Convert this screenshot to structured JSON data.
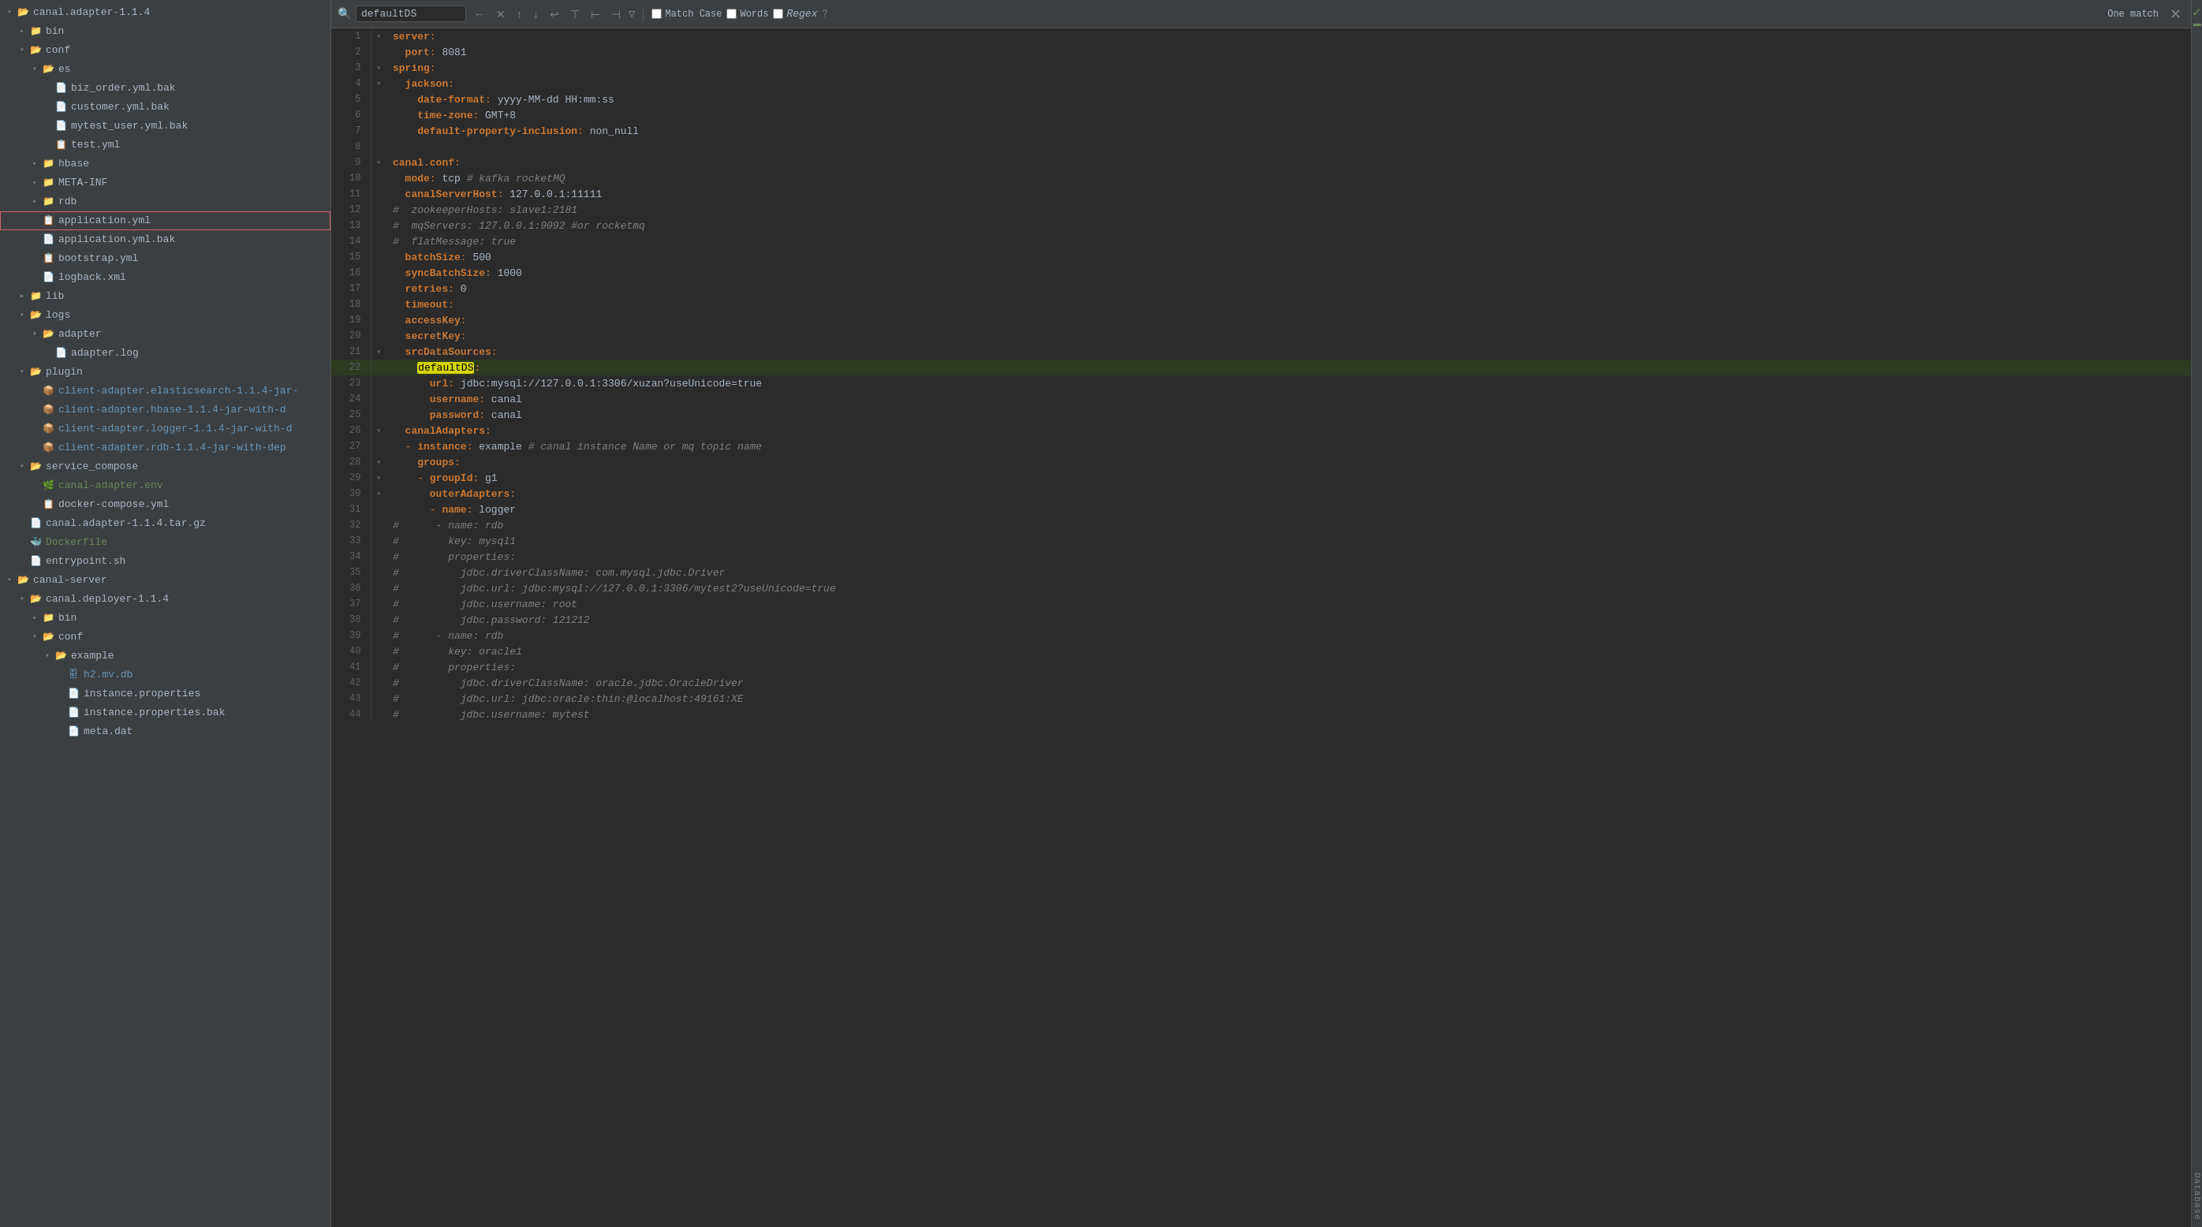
{
  "sidebar": {
    "items": [
      {
        "id": "canal-adapter-root",
        "label": "canal.adapter-1.1.4",
        "type": "folder",
        "depth": 0,
        "open": true,
        "icon": "folder"
      },
      {
        "id": "bin",
        "label": "bin",
        "type": "folder",
        "depth": 1,
        "open": false,
        "icon": "folder"
      },
      {
        "id": "conf",
        "label": "conf",
        "type": "folder",
        "depth": 1,
        "open": true,
        "icon": "folder"
      },
      {
        "id": "es",
        "label": "es",
        "type": "folder",
        "depth": 2,
        "open": true,
        "icon": "folder"
      },
      {
        "id": "biz_order",
        "label": "biz_order.yml.bak",
        "type": "file-bak",
        "depth": 3,
        "icon": "file"
      },
      {
        "id": "customer",
        "label": "customer.yml.bak",
        "type": "file-bak",
        "depth": 3,
        "icon": "file"
      },
      {
        "id": "mytest_user",
        "label": "mytest_user.yml.bak",
        "type": "file-bak",
        "depth": 3,
        "icon": "file"
      },
      {
        "id": "test_yml",
        "label": "test.yml",
        "type": "file-yml",
        "depth": 3,
        "icon": "file-yml"
      },
      {
        "id": "hbase",
        "label": "hbase",
        "type": "folder",
        "depth": 2,
        "open": false,
        "icon": "folder"
      },
      {
        "id": "META-INF",
        "label": "META-INF",
        "type": "folder",
        "depth": 2,
        "open": false,
        "icon": "folder"
      },
      {
        "id": "rdb",
        "label": "rdb",
        "type": "folder",
        "depth": 2,
        "open": false,
        "icon": "folder"
      },
      {
        "id": "application_yml",
        "label": "application.yml",
        "type": "file-yml",
        "depth": 2,
        "icon": "file-yml",
        "selected": true,
        "highlighted": true
      },
      {
        "id": "application_yml_bak",
        "label": "application.yml.bak",
        "type": "file-bak",
        "depth": 2,
        "icon": "file"
      },
      {
        "id": "bootstrap_yml",
        "label": "bootstrap.yml",
        "type": "file-yml",
        "depth": 2,
        "icon": "file-yml"
      },
      {
        "id": "logback_xml",
        "label": "logback.xml",
        "type": "file-xml",
        "depth": 2,
        "icon": "file"
      },
      {
        "id": "lib",
        "label": "lib",
        "type": "folder",
        "depth": 1,
        "open": false,
        "icon": "folder"
      },
      {
        "id": "logs",
        "label": "logs",
        "type": "folder",
        "depth": 1,
        "open": true,
        "icon": "folder"
      },
      {
        "id": "adapter",
        "label": "adapter",
        "type": "folder",
        "depth": 2,
        "open": true,
        "icon": "folder"
      },
      {
        "id": "adapter_log",
        "label": "adapter.log",
        "type": "file-log",
        "depth": 3,
        "icon": "file"
      },
      {
        "id": "plugin",
        "label": "plugin",
        "type": "folder",
        "depth": 1,
        "open": true,
        "icon": "folder"
      },
      {
        "id": "client-es",
        "label": "client-adapter.elasticsearch-1.1.4-jar-",
        "type": "file-jar",
        "depth": 2,
        "icon": "file-jar"
      },
      {
        "id": "client-hbase",
        "label": "client-adapter.hbase-1.1.4-jar-with-d",
        "type": "file-jar",
        "depth": 2,
        "icon": "file-jar"
      },
      {
        "id": "client-logger",
        "label": "client-adapter.logger-1.1.4-jar-with-d",
        "type": "file-jar",
        "depth": 2,
        "icon": "file-jar"
      },
      {
        "id": "client-rdb",
        "label": "client-adapter.rdb-1.1.4-jar-with-dep",
        "type": "file-jar",
        "depth": 2,
        "icon": "file-jar"
      },
      {
        "id": "service_compose",
        "label": "service_compose",
        "type": "folder",
        "depth": 1,
        "open": true,
        "icon": "folder"
      },
      {
        "id": "canal-adapter-env",
        "label": "canal-adapter.env",
        "type": "file-env",
        "depth": 2,
        "icon": "file-env"
      },
      {
        "id": "docker-compose",
        "label": "docker-compose.yml",
        "type": "file-yml",
        "depth": 2,
        "icon": "file-yml"
      },
      {
        "id": "canal-tar",
        "label": "canal.adapter-1.1.4.tar.gz",
        "type": "file-tar",
        "depth": 1,
        "icon": "file"
      },
      {
        "id": "dockerfile",
        "label": "Dockerfile",
        "type": "file-docker",
        "depth": 1,
        "icon": "file-docker"
      },
      {
        "id": "entrypoint",
        "label": "entrypoint.sh",
        "type": "file-sh",
        "depth": 1,
        "icon": "file"
      },
      {
        "id": "canal-server",
        "label": "canal-server",
        "type": "folder",
        "depth": 0,
        "open": true,
        "icon": "folder"
      },
      {
        "id": "canal-deployer",
        "label": "canal.deployer-1.1.4",
        "type": "folder",
        "depth": 1,
        "open": true,
        "icon": "folder"
      },
      {
        "id": "bin2",
        "label": "bin",
        "type": "folder",
        "depth": 2,
        "open": false,
        "icon": "folder"
      },
      {
        "id": "conf2",
        "label": "conf",
        "type": "folder",
        "depth": 2,
        "open": true,
        "icon": "folder"
      },
      {
        "id": "example",
        "label": "example",
        "type": "folder",
        "depth": 3,
        "open": true,
        "icon": "folder"
      },
      {
        "id": "h2mv",
        "label": "h2.mv.db",
        "type": "file-db",
        "depth": 4,
        "icon": "file-db"
      },
      {
        "id": "instance_props",
        "label": "instance.properties",
        "type": "file-props",
        "depth": 4,
        "icon": "file"
      },
      {
        "id": "instance_props_bak",
        "label": "instance.properties.bak",
        "type": "file-bak",
        "depth": 4,
        "icon": "file"
      },
      {
        "id": "meta_dat",
        "label": "meta.dat",
        "type": "file-dat",
        "depth": 4,
        "icon": "file"
      }
    ]
  },
  "search": {
    "query": "defaultDS",
    "placeholder": "Search",
    "match_case_label": "Match Case",
    "words_label": "Words",
    "regex_label": "Regex",
    "result_count": "One match",
    "match_case_checked": false,
    "words_checked": false,
    "regex_checked": false
  },
  "editor": {
    "filename": "application.yml",
    "lines": [
      {
        "num": 1,
        "content": "server:",
        "type": "key"
      },
      {
        "num": 2,
        "content": "  port: 8081",
        "type": "mixed"
      },
      {
        "num": 3,
        "content": "spring:",
        "type": "key"
      },
      {
        "num": 4,
        "content": "  jackson:",
        "type": "key"
      },
      {
        "num": 5,
        "content": "    date-format: yyyy-MM-dd HH:mm:ss",
        "type": "mixed"
      },
      {
        "num": 6,
        "content": "    time-zone: GMT+8",
        "type": "mixed"
      },
      {
        "num": 7,
        "content": "    default-property-inclusion: non_null",
        "type": "mixed"
      },
      {
        "num": 8,
        "content": "",
        "type": "empty"
      },
      {
        "num": 9,
        "content": "canal.conf:",
        "type": "key"
      },
      {
        "num": 10,
        "content": "  mode: tcp # kafka rocketMQ",
        "type": "mixed-comment"
      },
      {
        "num": 11,
        "content": "  canalServerHost: 127.0.0.1:11111",
        "type": "mixed"
      },
      {
        "num": 12,
        "content": "#  zookeeperHosts: slave1:2181",
        "type": "comment"
      },
      {
        "num": 13,
        "content": "#  mqServers: 127.0.0.1:9092 #or rocketmq",
        "type": "comment"
      },
      {
        "num": 14,
        "content": "#  flatMessage: true",
        "type": "comment"
      },
      {
        "num": 15,
        "content": "  batchSize: 500",
        "type": "mixed"
      },
      {
        "num": 16,
        "content": "  syncBatchSize: 1000",
        "type": "mixed"
      },
      {
        "num": 17,
        "content": "  retries: 0",
        "type": "mixed"
      },
      {
        "num": 18,
        "content": "  timeout:",
        "type": "key"
      },
      {
        "num": 19,
        "content": "  accessKey:",
        "type": "key"
      },
      {
        "num": 20,
        "content": "  secretKey:",
        "type": "key"
      },
      {
        "num": 21,
        "content": "  srcDataSources:",
        "type": "key"
      },
      {
        "num": 22,
        "content": "    defaultDS:",
        "type": "match-line"
      },
      {
        "num": 23,
        "content": "      url: jdbc:mysql://127.0.0.1:3306/xuzan?useUnicode=true",
        "type": "mixed"
      },
      {
        "num": 24,
        "content": "      username: canal",
        "type": "mixed"
      },
      {
        "num": 25,
        "content": "      password: canal",
        "type": "mixed"
      },
      {
        "num": 26,
        "content": "  canalAdapters:",
        "type": "key"
      },
      {
        "num": 27,
        "content": "  - instance: example # canal instance Name or mq topic name",
        "type": "mixed-comment"
      },
      {
        "num": 28,
        "content": "    groups:",
        "type": "key"
      },
      {
        "num": 29,
        "content": "    - groupId: g1",
        "type": "mixed"
      },
      {
        "num": 30,
        "content": "      outerAdapters:",
        "type": "key"
      },
      {
        "num": 31,
        "content": "      - name: logger",
        "type": "mixed"
      },
      {
        "num": 32,
        "content": "#      - name: rdb",
        "type": "comment"
      },
      {
        "num": 33,
        "content": "#        key: mysql1",
        "type": "comment"
      },
      {
        "num": 34,
        "content": "#        properties:",
        "type": "comment"
      },
      {
        "num": 35,
        "content": "#          jdbc.driverClassName: com.mysql.jdbc.Driver",
        "type": "comment"
      },
      {
        "num": 36,
        "content": "#          jdbc.url: jdbc:mysql://127.0.0.1:3306/mytest2?useUnicode=true",
        "type": "comment"
      },
      {
        "num": 37,
        "content": "#          jdbc.username: root",
        "type": "comment"
      },
      {
        "num": 38,
        "content": "#          jdbc.password: 121212",
        "type": "comment"
      },
      {
        "num": 39,
        "content": "#      - name: rdb",
        "type": "comment"
      },
      {
        "num": 40,
        "content": "#        key: oracle1",
        "type": "comment"
      },
      {
        "num": 41,
        "content": "#        properties:",
        "type": "comment"
      },
      {
        "num": 42,
        "content": "#          jdbc.driverClassName: oracle.jdbc.OracleDriver",
        "type": "comment"
      },
      {
        "num": 43,
        "content": "#          jdbc.url: jdbc:oracle:thin:@localhost:49161:XE",
        "type": "comment"
      },
      {
        "num": 44,
        "content": "#          jdbc.username: mytest",
        "type": "comment"
      }
    ],
    "match_line": 22,
    "match_term": "defaultDS"
  },
  "right_panel": {
    "db_label": "Database"
  }
}
